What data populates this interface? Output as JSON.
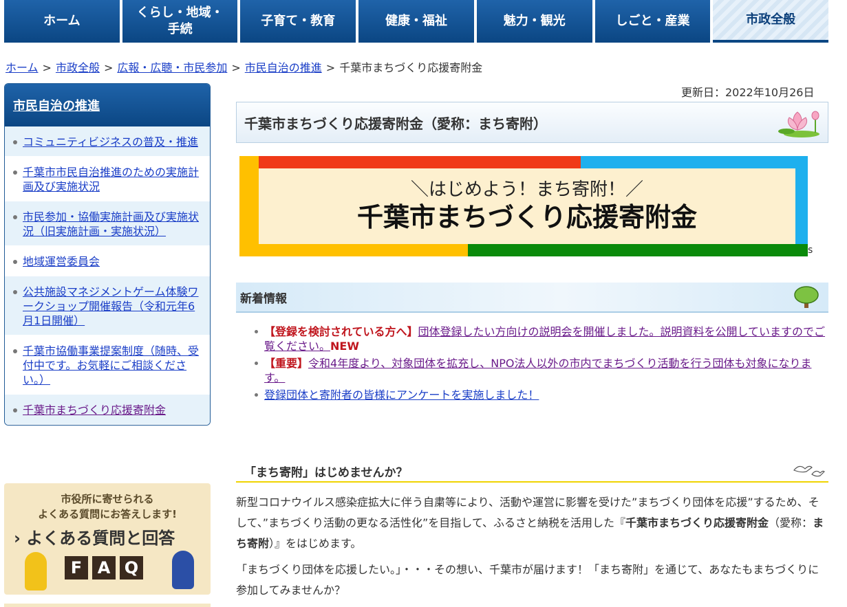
{
  "nav": {
    "items": [
      {
        "label": "ホーム"
      },
      {
        "label": "くらし・地域・\n手続"
      },
      {
        "label": "子育て・教育"
      },
      {
        "label": "健康・福祉"
      },
      {
        "label": "魅力・観光"
      },
      {
        "label": "しごと・産業"
      },
      {
        "label": "市政全般",
        "active": true
      }
    ]
  },
  "breadcrumb": {
    "links": [
      "ホーム",
      "市政全般",
      "広報・広聴・市民参加",
      "市民自治の推進"
    ],
    "current": "千葉市まちづくり応援寄附金",
    "separator": ">"
  },
  "sidebar": {
    "title": "市民自治の推進",
    "items": [
      {
        "label": "コミュニティビジネスの普及・推進"
      },
      {
        "label": "千葉市市民自治推進のための実施計画及び実施状況"
      },
      {
        "label": "市民参加・協働実施計画及び実施状況（旧実施計画・実施状況）"
      },
      {
        "label": "地域運営委員会"
      },
      {
        "label": "公共施設マネジメントゲーム体験ワークショップ開催報告（令和元年6月1日開催）"
      },
      {
        "label": "千葉市協働事業提案制度（随時、受付中です。お気軽にご相談ください。）"
      },
      {
        "label": "千葉市まちづくり応援寄附金"
      }
    ]
  },
  "faq_banner": {
    "line1": "市役所に寄せられる",
    "line2": "よくある質問にお答えします!",
    "title": "› よくある質問と回答",
    "letters": [
      "F",
      "A",
      "Q"
    ]
  },
  "page": {
    "updated": "更新日：2022年10月26日",
    "title": "千葉市まちづくり応援寄附金（愛称：まち寄附）"
  },
  "banner": {
    "subtitle": "＼はじめよう！まち寄附！／",
    "title": "千葉市まちづくり応援寄附金",
    "trailing_char": "s",
    "colors": {
      "red": "#f03a17",
      "blue": "#1eb0ee",
      "yellow": "#ffc000",
      "green": "#0a8a0a",
      "cream": "#fdf0cf"
    }
  },
  "news": {
    "heading": "新着情報",
    "items": [
      {
        "tag": "【登録を検討されている方へ】",
        "text": "団体登録したい方向けの説明会を開催しました。説明資料を公開していますのでご覧ください。",
        "badge": "NEW"
      },
      {
        "tag": "【重要】",
        "text": "令和4年度より、対象団体を拡充し、NPO法人以外の市内でまちづくり活動を行う団体も対象になります。"
      },
      {
        "tag": "",
        "text": "登録団体と寄附者の皆様にアンケートを実施しました！"
      }
    ]
  },
  "section": {
    "heading": "「まち寄附」はじめませんか？",
    "p1_a": "新型コロナウイルス感染症拡大に伴う自粛等により、活動や運営に影響を受けた”まちづくり団体を応援”するため、そして、”まちづくり活動の更なる活性化”を目指して、ふるさと納税を活用した『",
    "p1_b": "千葉市まちづくり応援寄附金",
    "p1_c": "（愛称：",
    "p1_d": "まち寄附",
    "p1_e": "）』をはじめます。",
    "p2": "「まちづくり団体を応援したい。」・・・その想い、千葉市が届けます！「まち寄附」を通じて、あなたもまちづくりに参加してみませんか？"
  }
}
